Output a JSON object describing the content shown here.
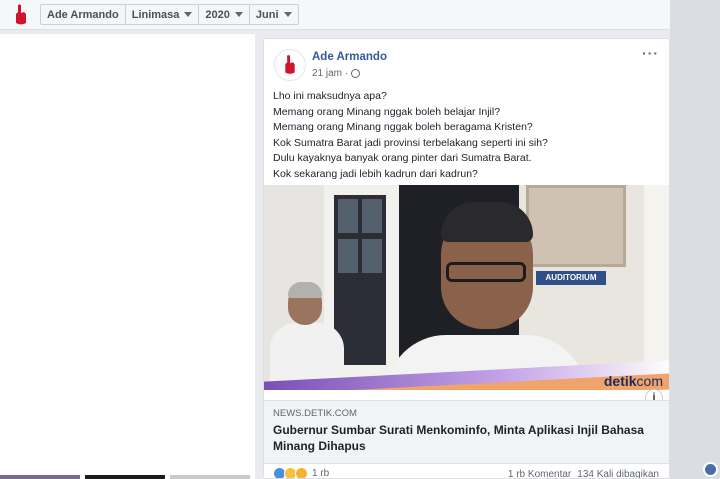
{
  "topbar": {
    "crumbs": [
      {
        "label": "Ade Armando",
        "caret": false
      },
      {
        "label": "Linimasa",
        "caret": true
      },
      {
        "label": "2020",
        "caret": true
      },
      {
        "label": "Juni",
        "caret": true
      }
    ]
  },
  "post": {
    "author": "Ade Armando",
    "time": "21 jam",
    "separator": "·",
    "more_label": "···",
    "lines": [
      "Lho ini maksudnya apa?",
      "Memang orang Minang nggak boleh belajar Injil?",
      "Memang orang Minang nggak boleh beragama Kristen?",
      "Kok Sumatra Barat jadi provinsi terbelakang seperti ini sih?",
      "Dulu kayaknya banyak orang pinter dari Sumatra Barat.",
      "Kok sekarang jadi lebih kadrun dari kadrun?"
    ],
    "image": {
      "sign_text": "AUDITORIUM",
      "watermark_main": "detik",
      "watermark_suffix": "com",
      "info_label": "i"
    },
    "link": {
      "domain": "NEWS.DETIK.COM",
      "title": "Gubernur Sumbar Surati Menkominfo, Minta Aplikasi Injil Bahasa Minang Dihapus"
    },
    "reactions": {
      "count": "1 rb",
      "comments": "1 rb Komentar",
      "shares": "134 Kali dibagikan"
    }
  },
  "colors": {
    "link_blue": "#385898",
    "bg": "#e9ebee",
    "logo_red": "#d0142b"
  },
  "icons": [
    "party-logo-icon",
    "chevron-down-icon",
    "globe-icon",
    "more-options-icon",
    "info-icon",
    "like-reaction-icon",
    "haha-reaction-icon",
    "wow-reaction-icon"
  ]
}
